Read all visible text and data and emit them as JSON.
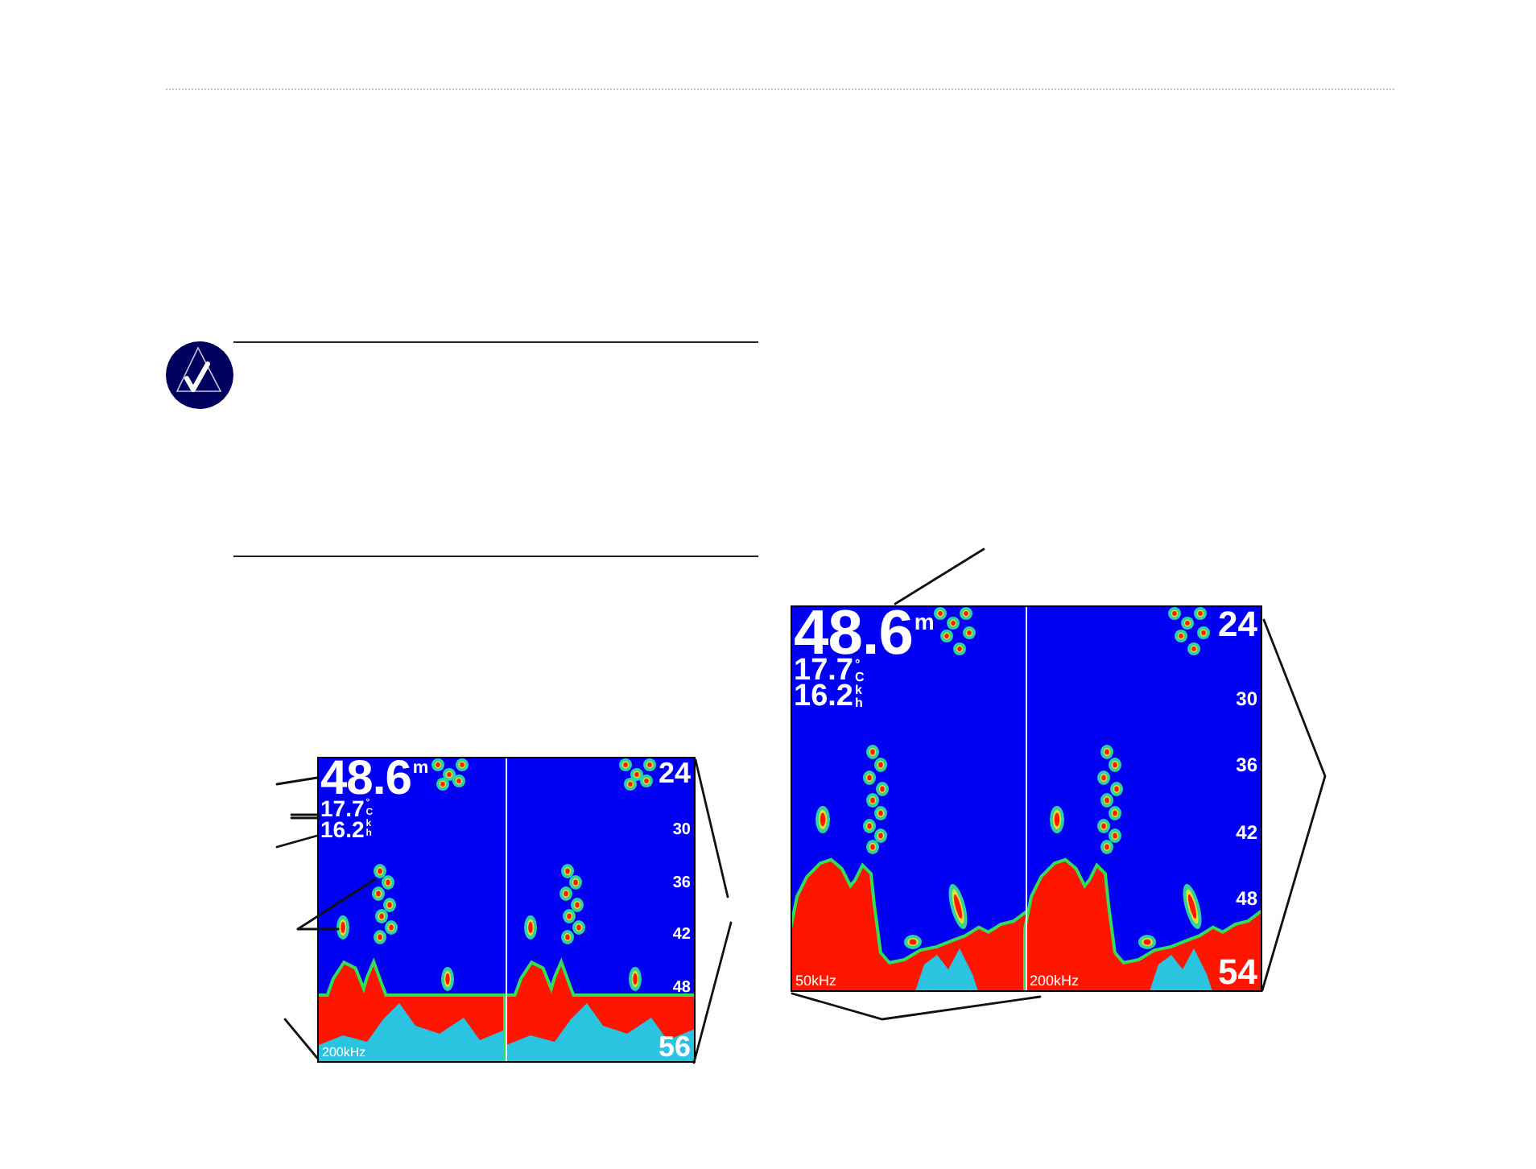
{
  "sonar_screens": [
    {
      "depth": "48.6",
      "depth_unit": "m",
      "temperature": "17.7",
      "temperature_unit": "°C",
      "speed": "16.2",
      "speed_unit": "kh",
      "depth_scale": [
        "24",
        "30",
        "36",
        "42",
        "48",
        "56"
      ],
      "frequency_labels": [
        "200kHz"
      ]
    },
    {
      "depth": "48.6",
      "depth_unit": "m",
      "temperature": "17.7",
      "temperature_unit": "°C",
      "speed": "16.2",
      "speed_unit": "kh",
      "depth_scale": [
        "24",
        "30",
        "36",
        "42",
        "48",
        "54"
      ],
      "frequency_labels": [
        "50kHz",
        "200kHz"
      ]
    }
  ]
}
